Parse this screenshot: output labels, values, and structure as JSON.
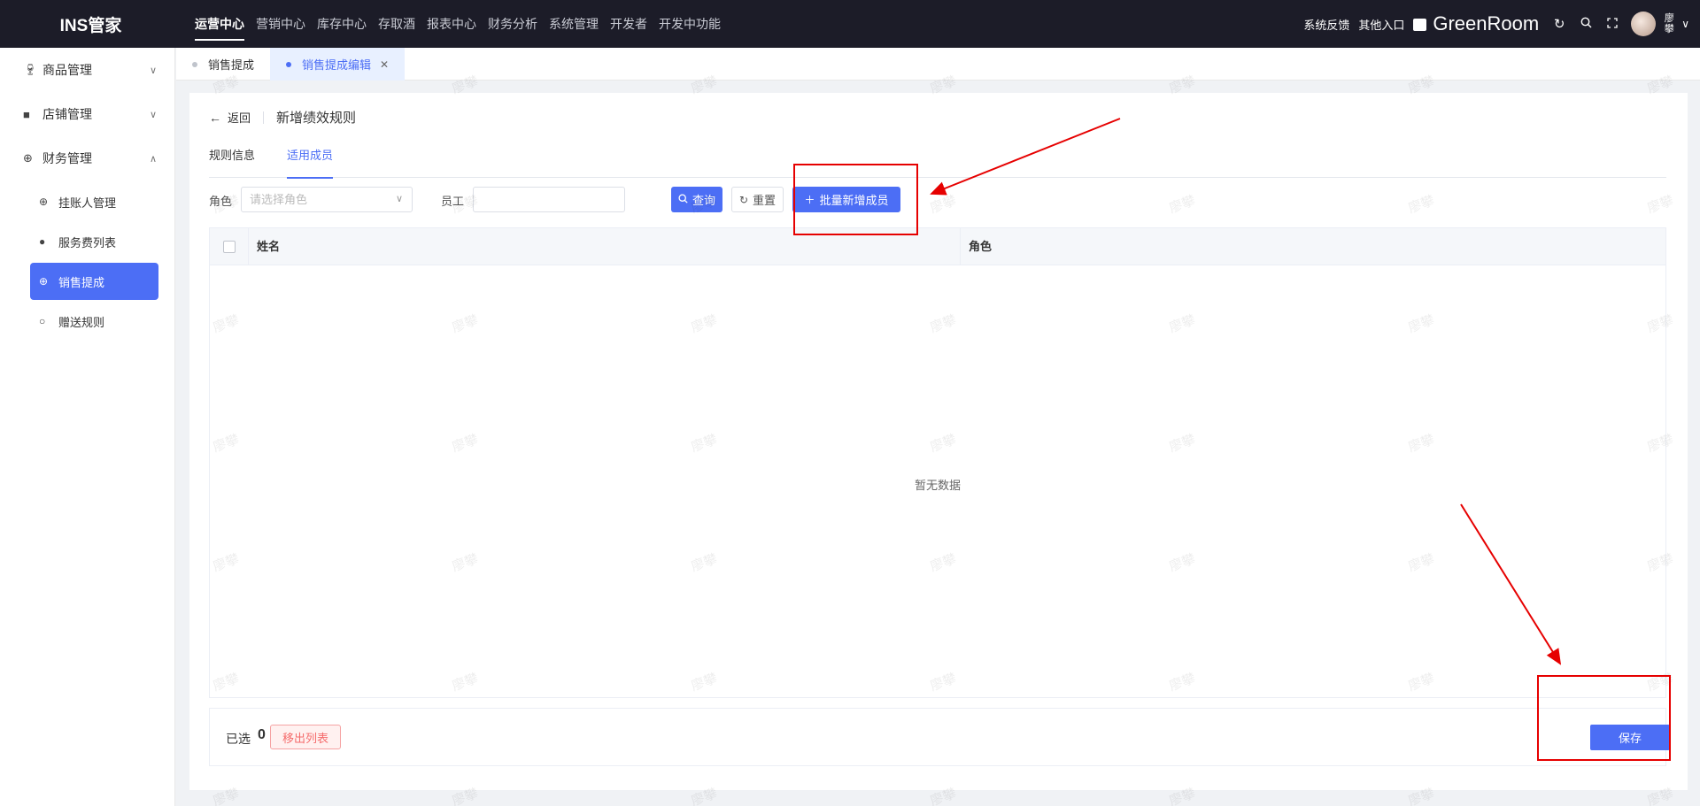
{
  "topbar": {
    "brand": "INS管家",
    "nav": [
      "运营中心",
      "营销中心",
      "库存中心",
      "存取酒",
      "报表中心",
      "财务分析",
      "系统管理",
      "开发者",
      "开发中功能"
    ],
    "active_nav": "运营中心",
    "feedback": "系统反馈",
    "other_entry": "其他入口",
    "store_name": "GreenRoom",
    "user_name": "廖攀",
    "icons": [
      "refresh-icon",
      "search-icon",
      "fullscreen-icon",
      "chevron-down-icon"
    ]
  },
  "sidebar": {
    "groups": [
      {
        "label": "商品管理",
        "icon": "goods-icon",
        "expanded": false
      },
      {
        "label": "店铺管理",
        "icon": "shop-icon",
        "expanded": false
      },
      {
        "label": "财务管理",
        "icon": "finance-icon",
        "expanded": true
      }
    ],
    "sub_items": [
      {
        "label": "挂账人管理",
        "icon": "target-icon",
        "active": false
      },
      {
        "label": "服务费列表",
        "icon": "user-icon",
        "active": false
      },
      {
        "label": "销售提成",
        "icon": "target-icon",
        "active": true
      },
      {
        "label": "赠送规则",
        "icon": "apple-icon",
        "active": false
      }
    ]
  },
  "tabs": [
    {
      "label": "销售提成",
      "active": false
    },
    {
      "label": "销售提成编辑",
      "active": true,
      "closable": true
    }
  ],
  "page": {
    "back_label": "返回",
    "title": "新增绩效规则",
    "subtabs": [
      "规则信息",
      "适用成员"
    ],
    "active_subtab": "适用成员"
  },
  "filters": {
    "role_label": "角色",
    "role_placeholder": "请选择角色",
    "staff_label": "员工",
    "staff_value": "",
    "query_label": "查询",
    "reset_label": "重置",
    "batch_add_label": "批量新增成员"
  },
  "table": {
    "columns": [
      "姓名",
      "角色"
    ],
    "rows": [],
    "empty_text": "暂无数据"
  },
  "footer": {
    "selected_label": "已选",
    "selected_count": "0",
    "remove_label": "移出列表",
    "save_label": "保存"
  },
  "watermark_text": "廖攀",
  "colors": {
    "primary": "#4c6ef5",
    "topbar_bg": "#1c1c28",
    "annotation_red": "#e60000",
    "danger": "#f56c6c"
  }
}
